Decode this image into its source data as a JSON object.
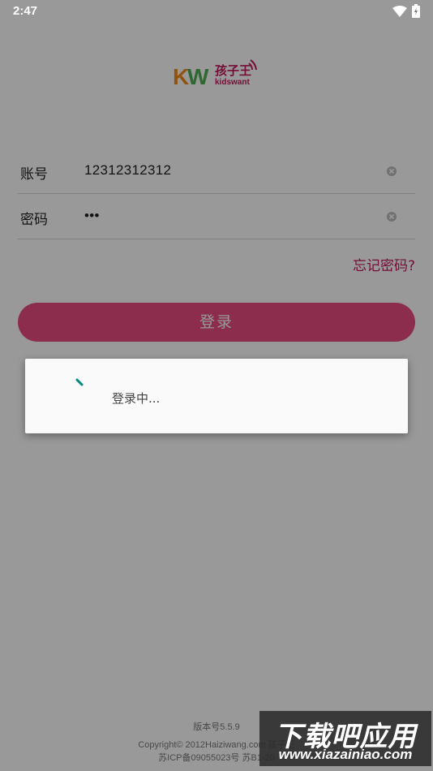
{
  "status_bar": {
    "time": "2:47"
  },
  "logo": {
    "brand_cn": "孩子王",
    "brand_en": "kidswant",
    "mark": "KW"
  },
  "form": {
    "account_label": "账号",
    "account_value": "12312312312",
    "password_label": "密码",
    "password_value": "•••",
    "forgot_label": "忘记密码?",
    "login_label": "登录"
  },
  "footer": {
    "version": "版本号5.5.9",
    "copyright": "Copyright© 2012Haiziwang.com 孩子王",
    "icp": "苏ICP备09055023号 苏B1-20"
  },
  "dialog": {
    "message": "登录中..."
  },
  "watermark": {
    "title": "下载吧应用",
    "url": "www.xiazainiao.com"
  },
  "colors": {
    "primary": "#ea4b83",
    "link": "#c2185b",
    "spinner": "#00897b"
  }
}
